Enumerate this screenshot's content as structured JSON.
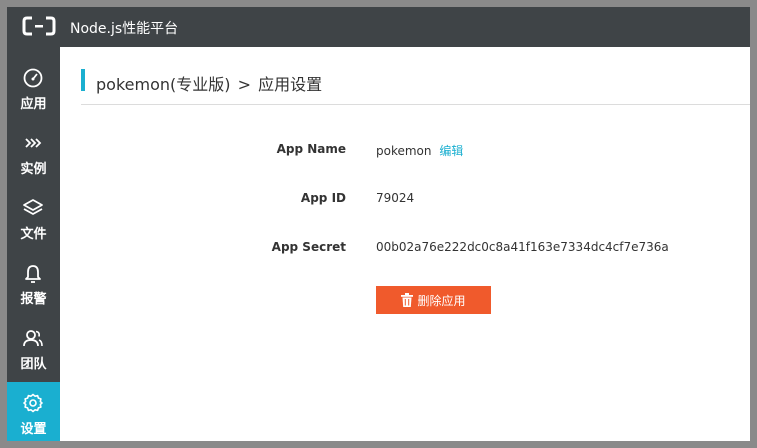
{
  "header": {
    "app_title": "Node.js性能平台",
    "logo_icon": "alibaba-cloud-logo-icon"
  },
  "sidebar": {
    "items": [
      {
        "label": "应用",
        "icon": "speedometer-icon",
        "active": false
      },
      {
        "label": "实例",
        "icon": "chevrons-right-icon",
        "active": false
      },
      {
        "label": "文件",
        "icon": "layers-icon",
        "active": false
      },
      {
        "label": "报警",
        "icon": "bell-icon",
        "active": false
      },
      {
        "label": "团队",
        "icon": "users-icon",
        "active": false
      },
      {
        "label": "设置",
        "icon": "gear-icon",
        "active": true
      }
    ],
    "active_color": "#1aafd0",
    "background_color": "#3f4447"
  },
  "page": {
    "breadcrumb_app": "pokemon(专业版)",
    "breadcrumb_separator": ">",
    "breadcrumb_page": "应用设置"
  },
  "settings": {
    "app_name_label": "App Name",
    "app_name_value": "pokemon",
    "edit_label": "编辑",
    "app_id_label": "App ID",
    "app_id_value": "79024",
    "app_secret_label": "App Secret",
    "app_secret_value": "00b02a76e222dc0c8a41f163e7334dc4cf7e736a",
    "delete_label": "删除应用",
    "delete_color": "#f05a2c"
  }
}
